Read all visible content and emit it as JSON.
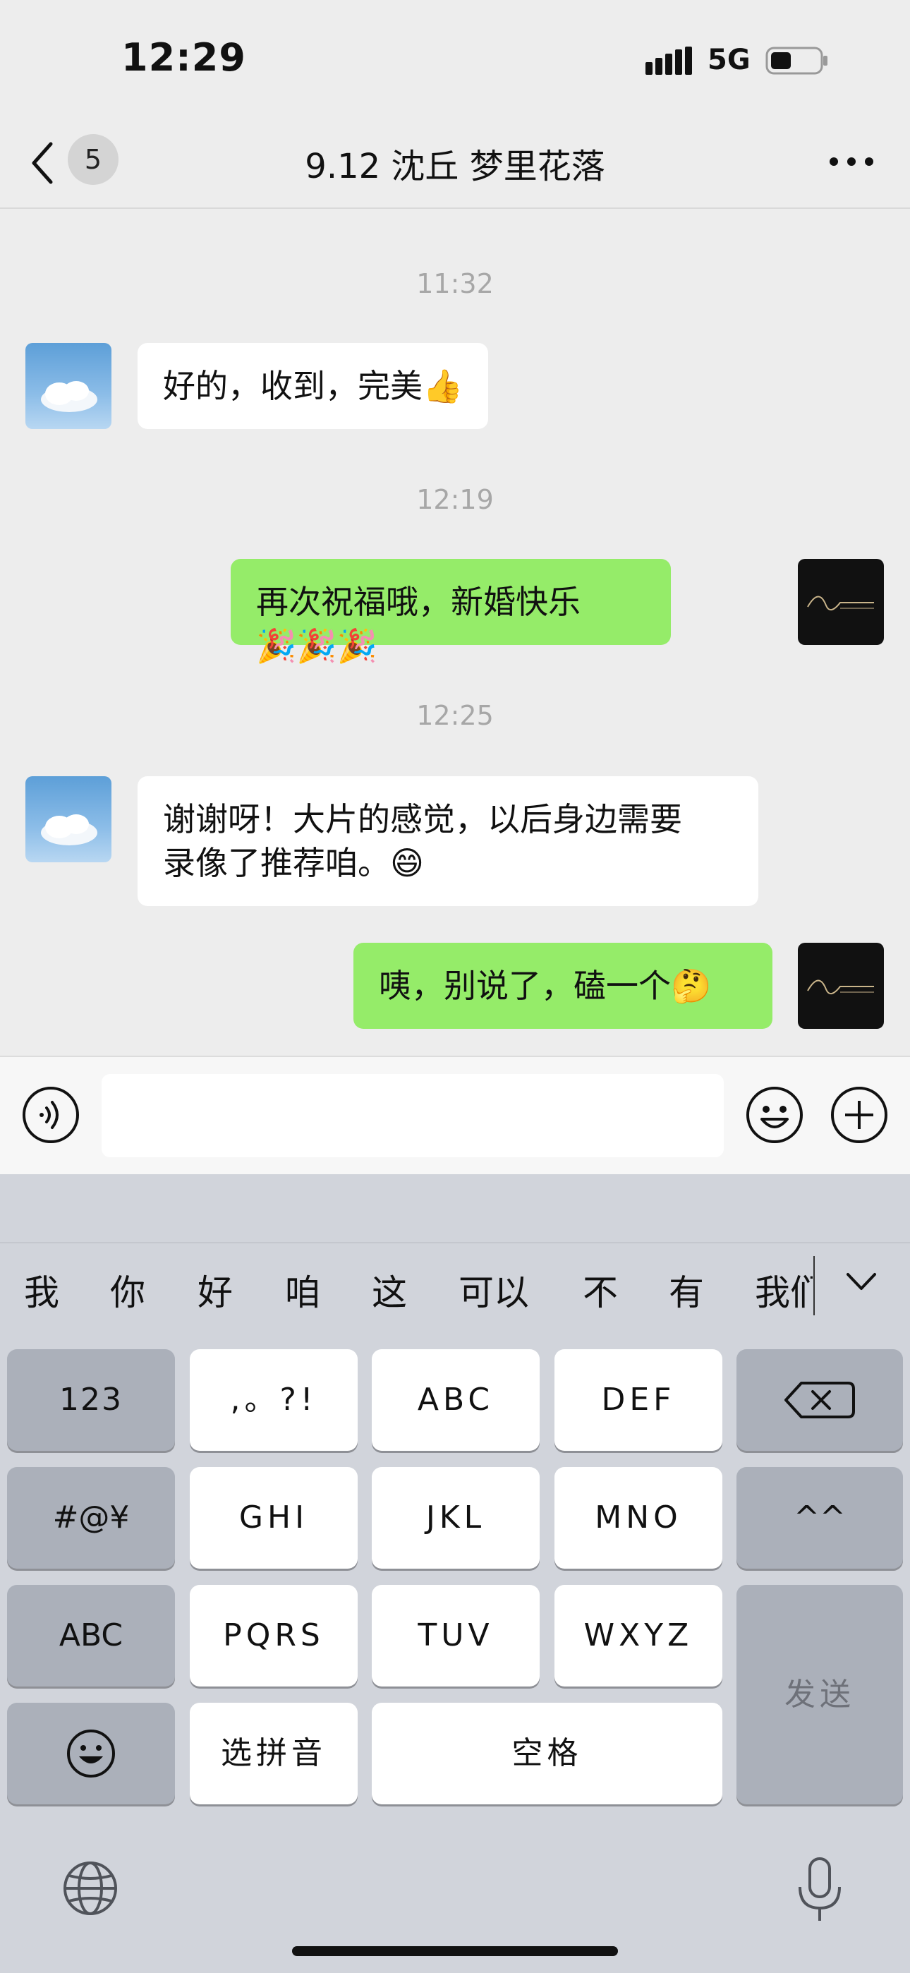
{
  "status_bar": {
    "time": "12:29",
    "network": "5G"
  },
  "header": {
    "back_badge": "5",
    "title": "9.12 沈丘 梦里花落"
  },
  "messages": [
    {
      "type": "timestamp",
      "text": "11:32"
    },
    {
      "type": "incoming",
      "text": "好的，收到，完美",
      "emoji": "👍"
    },
    {
      "type": "timestamp",
      "text": "12:19"
    },
    {
      "type": "outgoing",
      "text": "再次祝福哦，新婚快乐",
      "emoji": "🎉🎉🎉"
    },
    {
      "type": "timestamp",
      "text": "12:25"
    },
    {
      "type": "incoming",
      "line1": "谢谢呀！大片的感觉，以后身边需要",
      "line2": "录像了推荐咱。",
      "emoji": "😄"
    },
    {
      "type": "outgoing",
      "text": "咦，别说了，磕一个",
      "emoji": "🤔"
    }
  ],
  "input": {
    "value": ""
  },
  "keyboard": {
    "candidates": [
      "我",
      "你",
      "好",
      "咱",
      "这",
      "可以",
      "不",
      "有",
      "我们"
    ],
    "rows": {
      "r1": [
        "123",
        ",。?!",
        "ABC",
        "DEF"
      ],
      "r2": [
        "#@¥",
        "GHI",
        "JKL",
        "MNO",
        "^^"
      ],
      "r3": [
        "ABC",
        "PQRS",
        "TUV",
        "WXYZ"
      ],
      "r4": [
        "选拼音",
        "空格"
      ],
      "send": "发送"
    }
  },
  "icons": {
    "back": "chevron-left-icon",
    "more": "more-dots-icon",
    "voice": "voice-icon",
    "emoji": "smile-icon",
    "plus": "plus-icon",
    "backspace": "backspace-icon",
    "emoji_key": "emoji-key-icon",
    "globe": "globe-icon",
    "mic": "microphone-icon"
  },
  "colors": {
    "outgoing_bubble": "#95ec69",
    "incoming_bubble": "#ffffff",
    "chat_bg": "#ededed"
  }
}
